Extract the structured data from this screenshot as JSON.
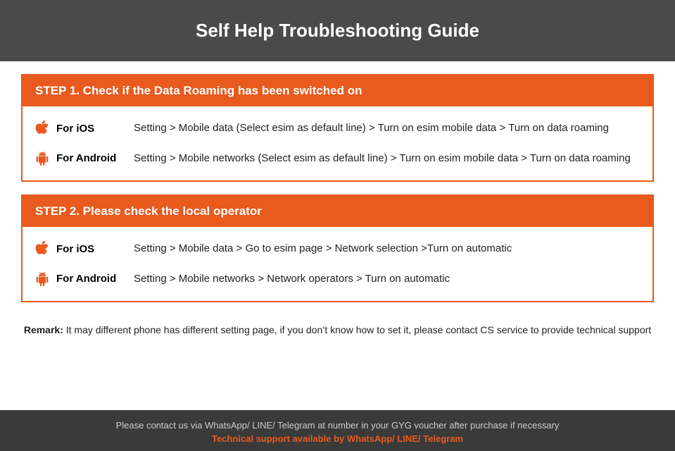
{
  "header": {
    "title": "Self Help Troubleshooting Guide"
  },
  "step1": {
    "title": "STEP 1.  Check if the Data Roaming has been switched on",
    "ios_label": "For iOS",
    "ios_instruction": "Setting > Mobile data (Select esim as default line) > Turn on esim mobile data > Turn on data roaming",
    "android_label": "For Android",
    "android_instruction": "Setting > Mobile networks (Select esim as default line) > Turn on esim mobile data > Turn on data roaming"
  },
  "step2": {
    "title": "STEP 2.  Please check the local operator",
    "ios_label": "For iOS",
    "ios_instruction": "Setting > Mobile data > Go to esim page > Network selection >Turn on automatic",
    "android_label": "For Android",
    "android_instruction": "Setting > Mobile networks > Network operators > Turn on automatic"
  },
  "remark": {
    "label": "Remark:",
    "text": " It may different phone has different setting page, if you don’t know how to set it,  please contact CS service to provide technical support"
  },
  "footer": {
    "contact_text": "Please contact us via WhatsApp/ LINE/ Telegram at number in your GYG voucher after purchase if necessary",
    "support_text": "Technical support available by WhatsApp/ LINE/ Telegram"
  },
  "icons": {
    "apple": "",
    "android": "🤖"
  },
  "colors": {
    "orange": "#e85a1e",
    "dark_header": "#4a4a4a",
    "footer_bg": "#3a3a3a"
  }
}
